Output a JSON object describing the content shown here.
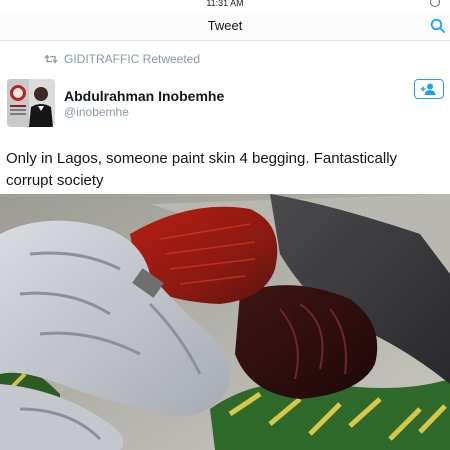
{
  "status_bar": {
    "time": "11:31 AM"
  },
  "nav": {
    "title": "Tweet",
    "search_icon": "search-icon"
  },
  "retweet": {
    "icon": "retweet-icon",
    "text": "GIDITRAFFIC Retweeted"
  },
  "tweet": {
    "author_name": "Abdulrahman Inobemhe",
    "author_handle": "@inobemhe",
    "follow_icon": "add-user-icon",
    "text": "Only in Lagos, someone paint skin 4 begging. Fantastically corrupt society"
  },
  "colors": {
    "accent": "#1da1f2",
    "secondary_text": "#8899a6",
    "divider": "#dfe3e6"
  }
}
